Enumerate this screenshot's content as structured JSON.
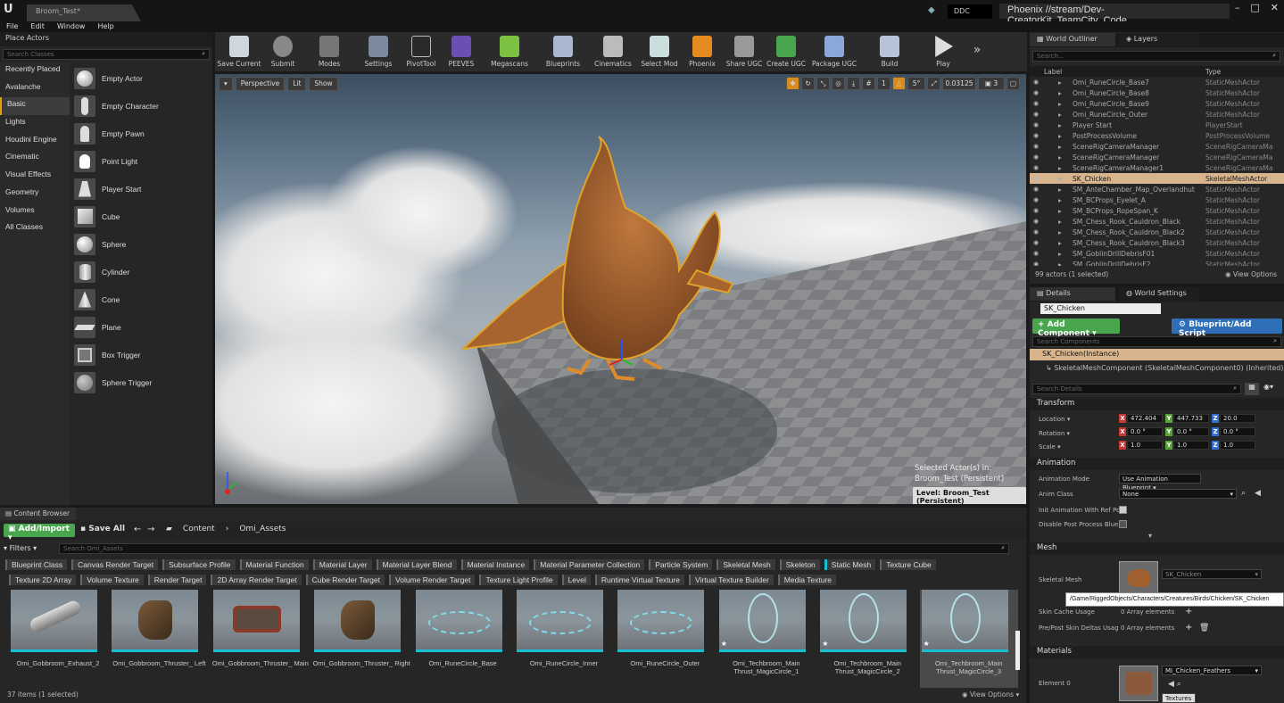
{
  "window": {
    "tab": "Broom_Test*",
    "project": "Phoenix //stream/Dev-CreatorKit_TeamCity_Code",
    "ddc": "DDC",
    "controls": [
      "–",
      "□",
      "✕"
    ]
  },
  "menu": [
    "File",
    "Edit",
    "Window",
    "Help"
  ],
  "place": {
    "title": "Place Actors",
    "search_placeholder": "Search Classes",
    "categories": [
      "Recently Placed",
      "Avalanche",
      "Basic",
      "Lights",
      "Houdini Engine",
      "Cinematic",
      "Visual Effects",
      "Geometry",
      "Volumes",
      "All Classes"
    ],
    "items": [
      "Empty Actor",
      "Empty Character",
      "Empty Pawn",
      "Point Light",
      "Player Start",
      "Cube",
      "Sphere",
      "Cylinder",
      "Cone",
      "Plane",
      "Box Trigger",
      "Sphere Trigger"
    ]
  },
  "toolbar": {
    "buttons": [
      "Save Current",
      "Submit",
      "Modes",
      "Settings",
      "PivotTool",
      "PEEVES",
      "Megascans",
      "Blueprints",
      "Cinematics",
      "Select Mod",
      "Phoenix",
      "Share UGC",
      "Create UGC",
      "Package UGC",
      "Build",
      "Play"
    ],
    "more": "»"
  },
  "viewport": {
    "perspective": "Perspective",
    "lit": "Lit",
    "show": "Show",
    "snap_angle": "5°",
    "snap_scale": "0.03125",
    "camera_speed": "3",
    "selected_line1": "Selected Actor(s) in:",
    "selected_line2": "Broom_Test (Persistent)",
    "level": "Level:  Broom_Test (Persistent)"
  },
  "outliner": {
    "tab1": "World Outliner",
    "tab2": "Layers",
    "search_placeholder": "Search...",
    "col_label": "Label",
    "col_type": "Type",
    "rows": [
      {
        "label": "Omi_RuneCircle_Base7",
        "type": "StaticMeshActor"
      },
      {
        "label": "Omi_RuneCircle_Base8",
        "type": "StaticMeshActor"
      },
      {
        "label": "Omi_RuneCircle_Base9",
        "type": "StaticMeshActor"
      },
      {
        "label": "Omi_RuneCircle_Outer",
        "type": "StaticMeshActor"
      },
      {
        "label": "Player Start",
        "type": "PlayerStart"
      },
      {
        "label": "PostProcessVolume",
        "type": "PostProcessVolume"
      },
      {
        "label": "SceneRigCameraManager",
        "type": "SceneRigCameraMa"
      },
      {
        "label": "SceneRigCameraManager",
        "type": "SceneRigCameraMa"
      },
      {
        "label": "SceneRigCameraManager1",
        "type": "SceneRigCameraMa"
      },
      {
        "label": "SK_Chicken",
        "type": "SkeletalMeshActor"
      },
      {
        "label": "SM_AnteChamber_Map_Overlandhut",
        "type": "StaticMeshActor"
      },
      {
        "label": "SM_BCProps_Eyelet_A",
        "type": "StaticMeshActor"
      },
      {
        "label": "SM_BCProps_RopeSpan_K",
        "type": "StaticMeshActor"
      },
      {
        "label": "SM_Chess_Rook_Cauldron_Black",
        "type": "StaticMeshActor"
      },
      {
        "label": "SM_Chess_Rook_Cauldron_Black2",
        "type": "StaticMeshActor"
      },
      {
        "label": "SM_Chess_Rook_Cauldron_Black3",
        "type": "StaticMeshActor"
      },
      {
        "label": "SM_GoblinDrillDebrisF01",
        "type": "StaticMeshActor"
      },
      {
        "label": "SM_GoblinDrillDebrisF2",
        "type": "StaticMeshActor"
      }
    ],
    "footer": "99 actors (1 selected)",
    "view_options": "View Options"
  },
  "details": {
    "tab1": "Details",
    "tab2": "World Settings",
    "name": "SK_Chicken",
    "add_component": "+ Add Component ▾",
    "blueprint": "Blueprint/Add Script",
    "comp_search": "Search Components",
    "instance": "SK_Chicken(Instance)",
    "skel_comp": "SkeletalMeshComponent (SkeletalMeshComponent0) (Inherited)",
    "search_details": "Search Details",
    "transform": "Transform",
    "location": "Location",
    "rotation": "Rotation",
    "scale": "Scale",
    "loc": [
      "472.404",
      "447.733",
      "20.0"
    ],
    "rot": [
      "0.0 °",
      "0.0 °",
      "0.0 °"
    ],
    "scl": [
      "1.0",
      "1.0",
      "1.0"
    ],
    "animation": "Animation",
    "anim_mode_label": "Animation Mode",
    "anim_mode": "Use Animation Blueprint",
    "anim_class_label": "Anim Class",
    "anim_class": "None",
    "init_anim": "Init Animation With Ref Po",
    "disable_pp": "Disable Post Process Blue",
    "mesh": "Mesh",
    "skel_mesh_label": "Skeletal Mesh",
    "skel_mesh": "SK_Chicken",
    "skin_cache": "Skin Cache Usage",
    "pre_post": "Pre/Post Skin Deltas Usag",
    "array_elems": "0 Array elements",
    "materials": "Materials",
    "element0": "Element 0",
    "material": "MI_Chicken_Feathers",
    "textures": "Textures"
  },
  "tooltip": "/Game/RiggedObjects/Characters/Creatures/Birds/Chicken/SK_Chicken",
  "content_browser": {
    "tab": "Content Browser",
    "add_import": "Add/Import",
    "save_all": "Save All",
    "crumb1": "Content",
    "crumb2": "Omi_Assets",
    "filters": "Filters",
    "search_placeholder": "Search Omi_Assets",
    "chips1": [
      "Blueprint Class",
      "Canvas Render Target",
      "Subsurface Profile",
      "Material Function",
      "Material Layer",
      "Material Layer Blend",
      "Material Instance",
      "Material Parameter Collection",
      "Particle System",
      "Skeletal Mesh",
      "Skeleton",
      "Static Mesh",
      "Texture Cube"
    ],
    "chips2": [
      "Texture 2D Array",
      "Volume Texture",
      "Render Target",
      "2D Array Render Target",
      "Cube Render Target",
      "Volume Render Target",
      "Texture Light Profile",
      "Level",
      "Runtime Virtual Texture",
      "Virtual Texture Builder",
      "Media Texture"
    ],
    "assets": [
      {
        "name": "Omi_Gobbroom_Exhaust_2",
        "kind": "pipe"
      },
      {
        "name": "Omi_Gobbroom_Thruster_ Left",
        "kind": "boot"
      },
      {
        "name": "Omi_Gobbroom_Thruster_ Main",
        "kind": "engine"
      },
      {
        "name": "Omi_Gobbroom_Thruster_ Right",
        "kind": "boot"
      },
      {
        "name": "Omi_RuneCircle_Base",
        "kind": "rune"
      },
      {
        "name": "Omi_RuneCircle_Inner",
        "kind": "rune"
      },
      {
        "name": "Omi_RuneCircle_Outer",
        "kind": "rune"
      },
      {
        "name": "Omi_Techbroom_Main Thrust_MagicCircle_1",
        "kind": "magic"
      },
      {
        "name": "Omi_Techbroom_Main Thrust_MagicCircle_2",
        "kind": "magic"
      },
      {
        "name": "Omi_Techbroom_Main Thrust_MagicCircle_3",
        "kind": "magic"
      }
    ],
    "status": "37 items (1 selected)",
    "view_options": "View Options"
  },
  "colors": {
    "accent": "#e4a100",
    "green": "#4aa54f",
    "blue": "#2f6fb8",
    "selection": "#d8b48c",
    "cyan": "#16c0d0"
  }
}
